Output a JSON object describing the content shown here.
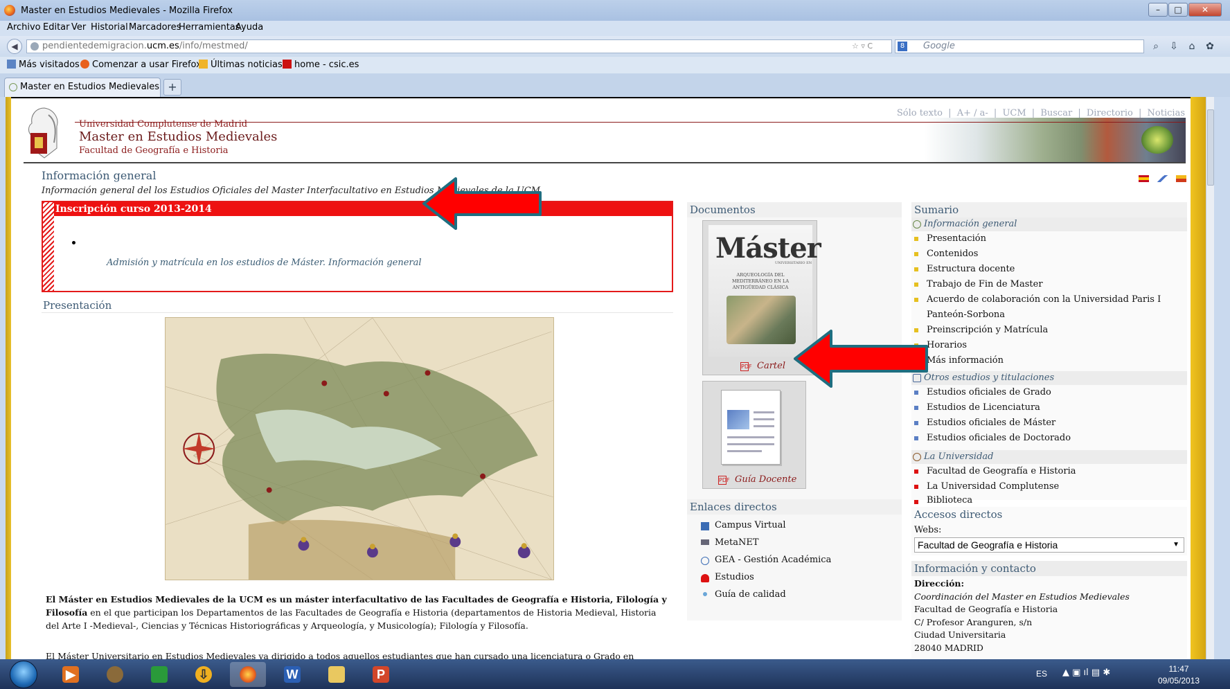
{
  "window": {
    "title": "Master en Estudios Medievales - Mozilla Firefox",
    "minimize": "–",
    "maximize": "□",
    "close": "✕"
  },
  "menu": [
    "Archivo",
    "Editar",
    "Ver",
    "Historial",
    "Marcadores",
    "Herramientas",
    "Ayuda"
  ],
  "navbar": {
    "url_prefix": "pendientedemigracion.",
    "url_domain": "ucm.es",
    "url_path": "/info/mestmed/",
    "url_icons": "☆ ▿ C",
    "search_placeholder": "Google",
    "search_engine_letter": "8"
  },
  "bookmarks": [
    "Más visitados",
    "Comenzar a usar Firefox",
    "Últimas noticias",
    "home - csic.es"
  ],
  "tab": {
    "label": "Master en Estudios Medievales",
    "new_tab": "+"
  },
  "header": {
    "links": [
      "Sólo texto",
      "|",
      "A+ / a-",
      "|",
      "UCM",
      "|",
      "Buscar",
      "|",
      "Directorio",
      "|",
      "Noticias"
    ],
    "university": "Universidad Complutense de Madrid",
    "site_title": "Master en Estudios Medievales",
    "faculty": "Facultad de Geografía e Historia"
  },
  "info": {
    "title": "Información general",
    "subtitle": "Información general del los Estudios Oficiales del Master Interfacultativo en Estudios Medievales de la UCM"
  },
  "inscription": {
    "title": "Inscripción curso 2013-2014",
    "link": "Admisión y matrícula en los estudios de Máster. Información general"
  },
  "presentation": {
    "title": "Presentación",
    "bold_text": "El Máster en Estudios Medievales de la UCM es un máster interfacultativo de las Facultades de Geografía e Historia, Filología y Filosofía",
    "text": " en el que participan los Departamentos de las Facultades de Geografía e Historia (departamentos de Historia Medieval, Historia del Arte I -Medieval-, Ciencias y Técnicas Historiográficas y Arqueología, y Musicología); Filología y Filosofía.",
    "text2": "El Máster Universitario en Estudios Medievales va dirigido a todos aquellos estudiantes que han cursado una licenciatura o Grado en Historia, Historia del Arte"
  },
  "documents": {
    "title": "Documentos",
    "poster_title": "Máster",
    "poster_small": "UNIVERSITARIO EN",
    "poster_sub": "ARQUEOLOGÍA DEL MEDITERRÁNEO EN LA ANTIGÜEDAD CLÁSICA",
    "cartel": "Cartel",
    "guia": "Guía Docente",
    "pdf": "PDF"
  },
  "direct_links": {
    "title": "Enlaces directos",
    "items": [
      "Campus Virtual",
      "MetaNET",
      "GEA - Gestión Académica",
      "Estudios",
      "Guía de calidad"
    ]
  },
  "sumario": {
    "title": "Sumario",
    "groups": [
      {
        "label": "Información general",
        "items": [
          "Presentación",
          "Contenidos",
          "Estructura docente",
          "Trabajo de Fin de Master",
          "Acuerdo de colaboración con la Universidad Paris I Panteón-Sorbona",
          "Preinscripción y Matrícula",
          "Horarios",
          "Más información"
        ]
      },
      {
        "label": "Otros estudios y titulaciones",
        "items": [
          "Estudios oficiales de Grado",
          "Estudios de Licenciatura",
          "Estudios oficiales de Máster",
          "Estudios oficiales de Doctorado"
        ]
      },
      {
        "label": "La Universidad",
        "items": [
          "Facultad de Geografía e Historia",
          "La Universidad Complutense",
          "Biblioteca"
        ]
      }
    ]
  },
  "accesos": {
    "title": "Accesos directos",
    "webs_label": "Webs:",
    "selected": "Facultad de Geografía e Historia"
  },
  "contact": {
    "title": "Información y contacto",
    "direccion_label": "Dirección:",
    "lines": [
      "Coordinación del Master en Estudios Medievales",
      "Facultad de Geografía e Historia",
      "C/ Profesor Aranguren, s/n",
      "Ciudad Universitaria",
      "28040 MADRID"
    ]
  },
  "taskbar": {
    "apps": [
      "media-player",
      "gimp",
      "green-app",
      "vlc-like",
      "firefox",
      "word",
      "explorer",
      "powerpoint"
    ],
    "app_letters": [
      "",
      "",
      "",
      "",
      "",
      "W",
      "",
      "P"
    ],
    "lang": "ES",
    "time": "11:47",
    "date": "09/05/2013"
  },
  "colors": {
    "accent_red": "#ee1111",
    "heading_blue": "#3d5a74",
    "ucm_red": "#8b1a1a",
    "arrow_red": "#ff0000",
    "arrow_border": "#1f6e80"
  }
}
